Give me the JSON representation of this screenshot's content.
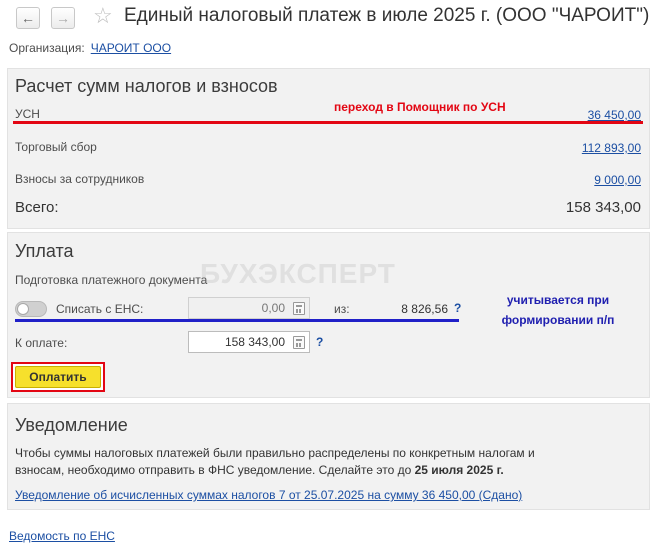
{
  "window": {
    "title": "Единый налоговый платеж в июле 2025 г. (ООО \"ЧАРОИТ\")",
    "back_glyph": "←",
    "forward_glyph": "→",
    "star_glyph": "☆"
  },
  "organization": {
    "label": "Организация:",
    "value": "ЧАРОИТ ООО"
  },
  "calc": {
    "title": "Расчет сумм налогов и взносов",
    "rows": [
      {
        "label": "УСН",
        "amount": "36 450,00"
      },
      {
        "label": "Торговый сбор",
        "amount": "112 893,00"
      },
      {
        "label": "Взносы за сотрудников",
        "amount": "9 000,00"
      }
    ],
    "total_label": "Всего:",
    "total_value": "158 343,00",
    "annotation": "переход в Помощник по УСН"
  },
  "payment": {
    "title": "Уплата",
    "subtitle": "Подготовка платежного документа",
    "toggle_label": "Списать с ЕНС:",
    "toggle_on": false,
    "ens_amount": "0,00",
    "from_label": "из:",
    "ens_total": "8 826,56",
    "help_glyph": "?",
    "to_pay_label": "К оплате:",
    "to_pay_amount": "158 343,00",
    "pay_button": "Оплатить",
    "annotation_line1": "учитывается при",
    "annotation_line2": "формировании п/п"
  },
  "watermark": "БУХЭКСПЕРТ",
  "notice": {
    "title": "Уведомление",
    "text_line1": "Чтобы суммы налоговых платежей были правильно распределены по конкретным налогам и",
    "text_line2_prefix": "взносам, необходимо отправить в ФНС уведомление. Сделайте это до ",
    "text_line2_bold": "25 июля 2025 г.",
    "link": "Уведомление об исчисленных суммах налогов 7 от 25.07.2025 на сумму 36 450,00 (Сдано)"
  },
  "footer": {
    "link": "Ведомость по ЕНС"
  },
  "colors": {
    "panel_bg": "#f2f2f2",
    "link": "#1c4fa3",
    "annotation_red": "#e30613",
    "annotation_blue": "#2020c8",
    "pay_button": "#f6e02c"
  }
}
